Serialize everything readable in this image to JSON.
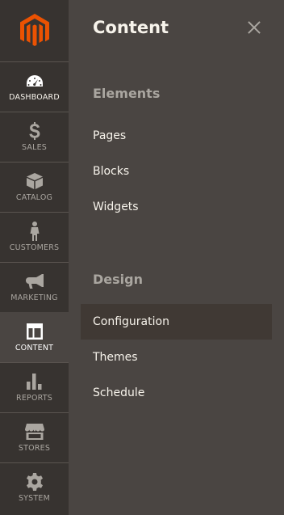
{
  "sidebar": {
    "logo_icon": "magento-logo-icon",
    "accent_color": "#eb5202",
    "items": [
      {
        "label": "DASHBOARD",
        "icon": "speedometer-icon"
      },
      {
        "label": "SALES",
        "icon": "dollar-icon"
      },
      {
        "label": "CATALOG",
        "icon": "box-icon"
      },
      {
        "label": "CUSTOMERS",
        "icon": "person-icon"
      },
      {
        "label": "MARKETING",
        "icon": "megaphone-icon"
      },
      {
        "label": "CONTENT",
        "icon": "layout-icon"
      },
      {
        "label": "REPORTS",
        "icon": "bar-chart-icon"
      },
      {
        "label": "STORES",
        "icon": "storefront-icon"
      },
      {
        "label": "SYSTEM",
        "icon": "gear-icon"
      }
    ],
    "active_item": "CONTENT"
  },
  "panel": {
    "title": "Content",
    "close_icon": "close-icon",
    "groups": [
      {
        "title": "Elements",
        "items": [
          "Pages",
          "Blocks",
          "Widgets"
        ]
      },
      {
        "title": "Design",
        "items": [
          "Configuration",
          "Themes",
          "Schedule"
        ]
      }
    ],
    "active_item": "Configuration"
  }
}
